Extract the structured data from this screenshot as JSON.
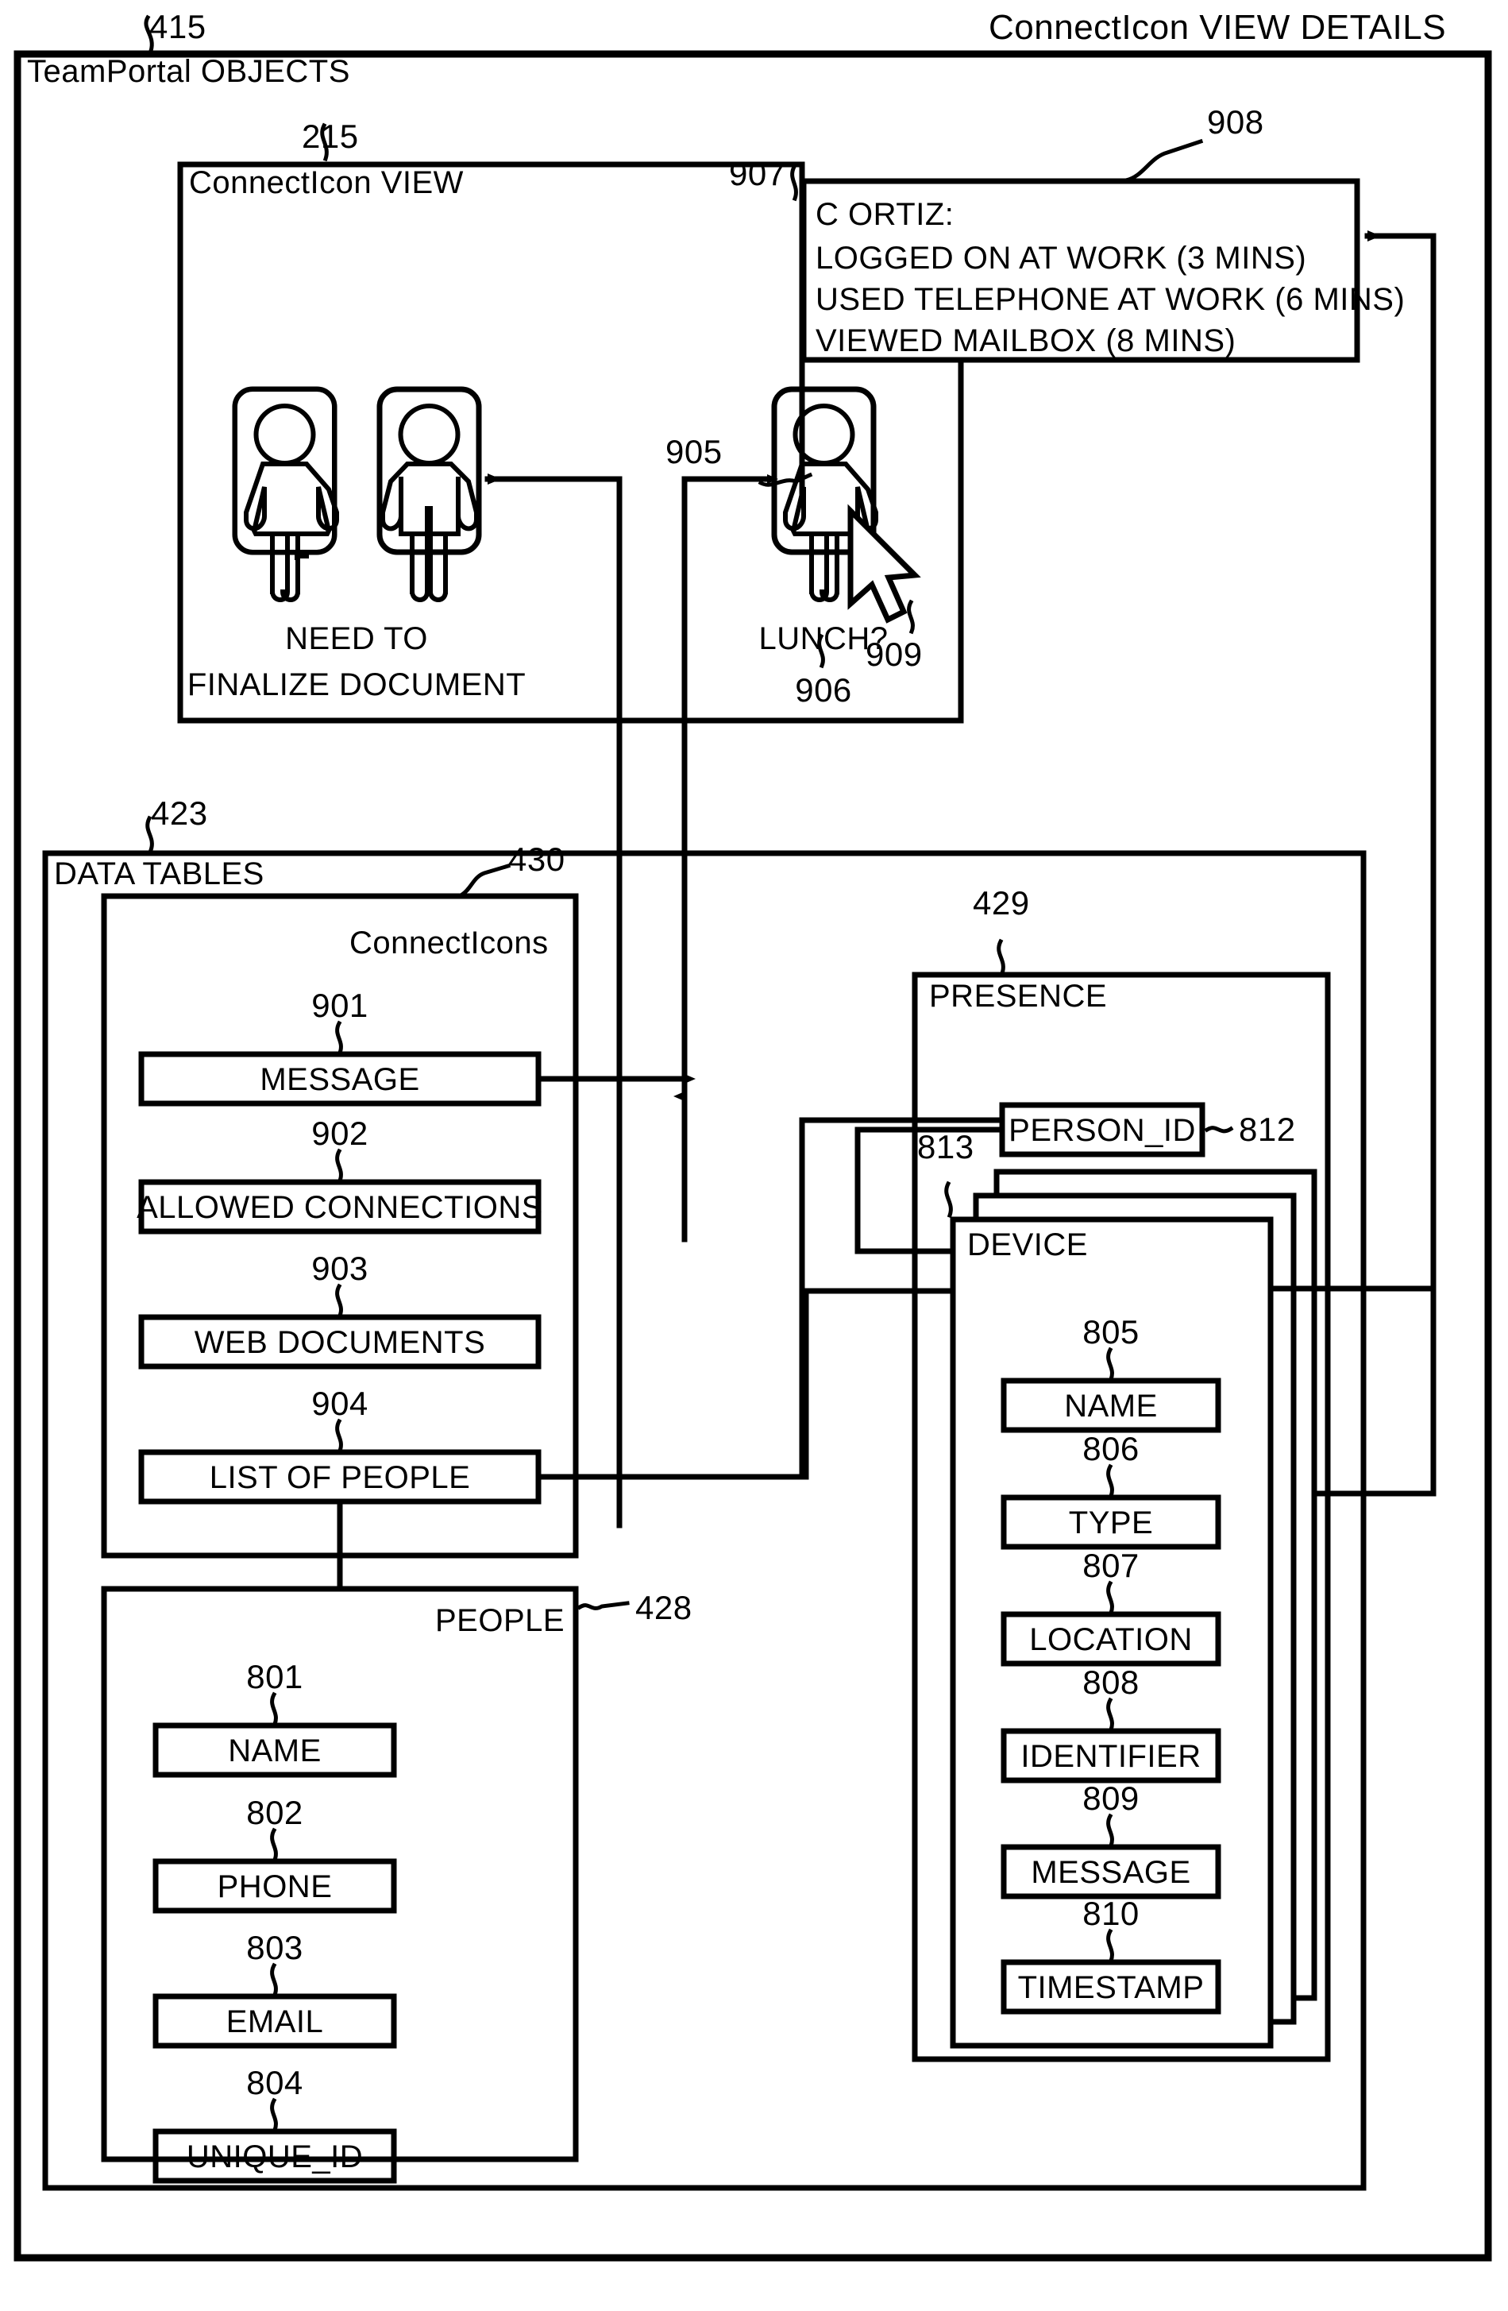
{
  "page": {
    "header_title": "ConnectIcon VIEW DETAILS",
    "outer_frame_label": "TeamPortal OBJECTS",
    "outer_frame_ref": "415"
  },
  "connecticon_view": {
    "ref": "215",
    "label": "ConnectIcon VIEW",
    "icons": [
      {
        "ref": "",
        "figure": "female-person-icon",
        "caption": ""
      },
      {
        "ref": "",
        "figure": "male-person-icon",
        "caption": ""
      }
    ],
    "caption_line1": "NEED TO",
    "caption_line2": "FINALIZE DOCUMENT"
  },
  "selected_icon": {
    "container_ref": "907",
    "icon_ref": "905",
    "caption_ref": "906",
    "caption": "LUNCH?",
    "cursor_ref": "909",
    "figure": "female-person-icon"
  },
  "details_popup": {
    "ref": "908",
    "lines": [
      "C ORTIZ:",
      "LOGGED ON AT WORK (3 MINS)",
      "USED TELEPHONE AT WORK (6 MINS)",
      "VIEWED MAILBOX (8 MINS)"
    ]
  },
  "data_tables": {
    "ref": "423",
    "label": "DATA TABLES",
    "connecticons": {
      "ref": "430",
      "label": "ConnectIcons",
      "fields": [
        {
          "ref": "901",
          "label": "MESSAGE"
        },
        {
          "ref": "902",
          "label": "ALLOWED CONNECTIONS"
        },
        {
          "ref": "903",
          "label": "WEB DOCUMENTS"
        },
        {
          "ref": "904",
          "label": "LIST OF PEOPLE"
        }
      ]
    },
    "people": {
      "ref": "428",
      "label": "PEOPLE",
      "fields": [
        {
          "ref": "801",
          "label": "NAME"
        },
        {
          "ref": "802",
          "label": "PHONE"
        },
        {
          "ref": "803",
          "label": "EMAIL"
        },
        {
          "ref": "804",
          "label": "UNIQUE_ID"
        }
      ]
    },
    "presence": {
      "ref": "429",
      "label": "PRESENCE",
      "person_id": {
        "ref": "812",
        "label": "PERSON_ID"
      },
      "device": {
        "ref": "813",
        "label": "DEVICE",
        "fields": [
          {
            "ref": "805",
            "label": "NAME"
          },
          {
            "ref": "806",
            "label": "TYPE"
          },
          {
            "ref": "807",
            "label": "LOCATION"
          },
          {
            "ref": "808",
            "label": "IDENTIFIER"
          },
          {
            "ref": "809",
            "label": "MESSAGE"
          },
          {
            "ref": "810",
            "label": "TIMESTAMP"
          }
        ]
      }
    }
  },
  "colors": {
    "ink": "#000000",
    "paper": "#ffffff"
  }
}
